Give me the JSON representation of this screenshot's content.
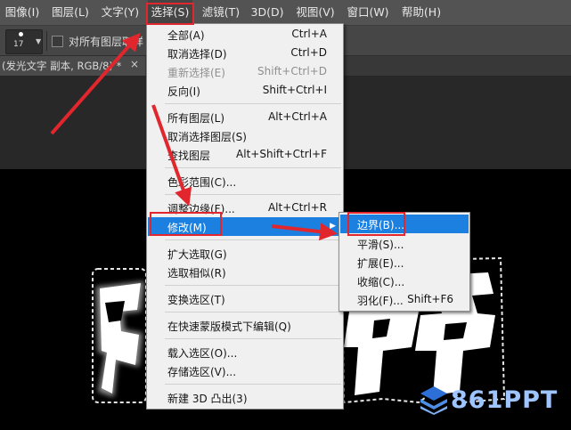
{
  "menubar": {
    "items": [
      {
        "label": "图像(I)"
      },
      {
        "label": "图层(L)"
      },
      {
        "label": "文字(Y)"
      },
      {
        "label": "选择(S)",
        "active": true
      },
      {
        "label": "滤镜(T)"
      },
      {
        "label": "3D(D)"
      },
      {
        "label": "视图(V)"
      },
      {
        "label": "窗口(W)"
      },
      {
        "label": "帮助(H)"
      }
    ]
  },
  "options_bar": {
    "brush_size": "17",
    "sample_all_layers_label": "对所有图层取样",
    "sample_all_layers_checked": false
  },
  "document_tab": {
    "label": "(发光文字 副本, RGB/8) *",
    "close_label": "×"
  },
  "select_menu": {
    "items": [
      {
        "label": "全部(A)",
        "shortcut": "Ctrl+A"
      },
      {
        "label": "取消选择(D)",
        "shortcut": "Ctrl+D"
      },
      {
        "label": "重新选择(E)",
        "shortcut": "Shift+Ctrl+D",
        "disabled": true
      },
      {
        "label": "反向(I)",
        "shortcut": "Shift+Ctrl+I"
      },
      {
        "label": "所有图层(L)",
        "shortcut": "Alt+Ctrl+A"
      },
      {
        "label": "取消选择图层(S)",
        "shortcut": ""
      },
      {
        "label": "查找图层",
        "shortcut": "Alt+Shift+Ctrl+F"
      },
      {
        "label": "色彩范围(C)...",
        "shortcut": ""
      },
      {
        "label": "调整边缘(F)...",
        "shortcut": "Alt+Ctrl+R"
      },
      {
        "label": "修改(M)",
        "shortcut": "",
        "submenu": true,
        "highlighted": true
      },
      {
        "label": "扩大选取(G)",
        "shortcut": ""
      },
      {
        "label": "选取相似(R)",
        "shortcut": ""
      },
      {
        "label": "变换选区(T)",
        "shortcut": ""
      },
      {
        "label": "在快速蒙版模式下编辑(Q)",
        "shortcut": ""
      },
      {
        "label": "载入选区(O)...",
        "shortcut": ""
      },
      {
        "label": "存储选区(V)...",
        "shortcut": ""
      },
      {
        "label": "新建 3D 凸出(3)",
        "shortcut": ""
      }
    ]
  },
  "modify_submenu": {
    "items": [
      {
        "label": "边界(B)...",
        "shortcut": "",
        "highlighted": true
      },
      {
        "label": "平滑(S)...",
        "shortcut": ""
      },
      {
        "label": "扩展(E)...",
        "shortcut": ""
      },
      {
        "label": "收缩(C)...",
        "shortcut": ""
      },
      {
        "label": "羽化(F)...",
        "shortcut": "Shift+F6"
      }
    ]
  },
  "watermark": {
    "text": "861PPT"
  },
  "colors": {
    "highlight": "#1c80e0",
    "annotation_red": "#e2262d",
    "watermark": "#9ec5ff"
  }
}
